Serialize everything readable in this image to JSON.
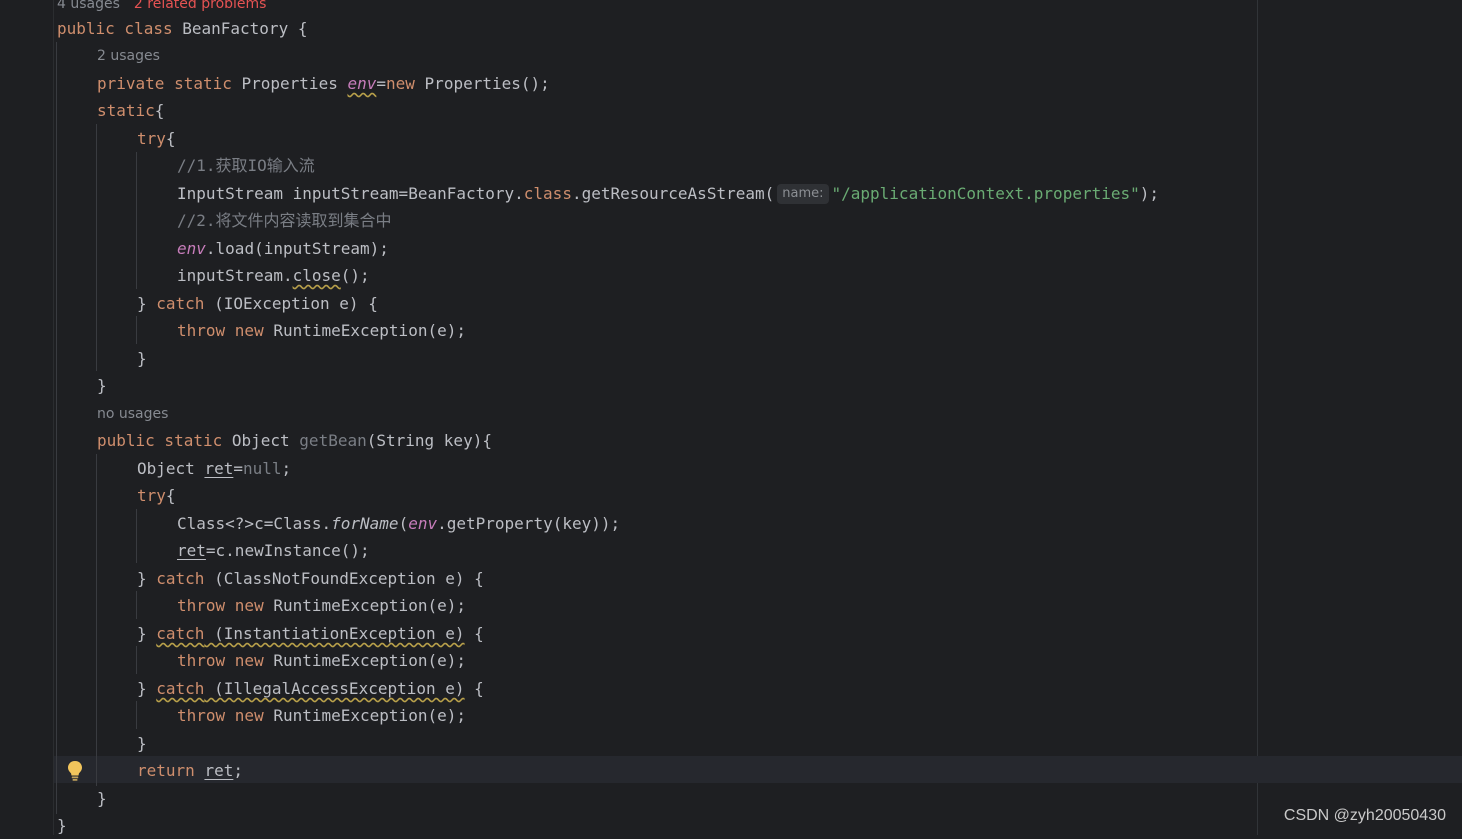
{
  "inlays": {
    "class_usages": "4 usages",
    "class_problems": "2 related problems",
    "field_usages": "2 usages",
    "method_usages": "no usages"
  },
  "code": {
    "l1_kw": "public class ",
    "l1_rest": "BeanFactory {",
    "l2_kw": "private static ",
    "l2_type": "Properties ",
    "l2_field": "env",
    "l2_eq": "=",
    "l2_new": "new ",
    "l2_rest": "Properties();",
    "l3_kw": "static",
    "l3_rest": "{",
    "l4_kw": "try",
    "l4_rest": "{",
    "l5_comment": "//1.获取IO输入流",
    "l6_pre": "InputStream inputStream=BeanFactory.",
    "l6_cls": "class",
    "l6_mid": ".getResourceAsStream(",
    "l6_hint": "name:",
    "l6_str": "\"/applicationContext.properties\"",
    "l6_end": ");",
    "l7_comment": "//2.将文件内容读取到集合中",
    "l8_field": "env",
    "l8_rest": ".load(inputStream);",
    "l9_pre": "inputStream.",
    "l9_close": "close",
    "l9_end": "();",
    "l10_brace": "} ",
    "l10_kw": "catch",
    "l10_rest": " (IOException e) {",
    "l11_kw": "throw new ",
    "l11_rest": "RuntimeException(e);",
    "l12": "}",
    "l13": "}",
    "l14_kw": "public static ",
    "l14_type": "Object ",
    "l14_name": "getBean",
    "l14_rest": "(String key){",
    "l15_type": "Object ",
    "l15_var": "ret",
    "l15_eq": "=",
    "l15_null": "null",
    "l15_end": ";",
    "l16_kw": "try",
    "l16_rest": "{",
    "l17_pre": "Class<?>c=Class.",
    "l17_forname": "forName",
    "l17_open": "(",
    "l17_field": "env",
    "l17_rest": ".getProperty(key));",
    "l18_var": "ret",
    "l18_rest": "=c.newInstance();",
    "l19_brace": "} ",
    "l19_kw": "catch",
    "l19_rest": " (ClassNotFoundException e) {",
    "l20_kw": "throw new ",
    "l20_rest": "RuntimeException(e);",
    "l21_brace": "} ",
    "l21_kw": "catch",
    "l21_u": " (InstantiationException e)",
    "l21_end": " {",
    "l22_kw": "throw new ",
    "l22_rest": "RuntimeException(e);",
    "l23_brace": "} ",
    "l23_kw": "catch",
    "l23_u": " (IllegalAccessException e)",
    "l23_end": " {",
    "l24_kw": "throw new ",
    "l24_rest": "RuntimeException(e);",
    "l25": "}",
    "l26_kw": "return ",
    "l26_var": "ret",
    "l26_end": ";",
    "l27": "}",
    "l28": "}"
  },
  "watermark": "CSDN @zyh20050430",
  "colors": {
    "background": "#1e1f22",
    "keyword": "#cf8e6d",
    "field": "#c77dbb",
    "string": "#6aab73",
    "comment": "#7a7e85",
    "text": "#bcbec4",
    "problems": "#e55353"
  }
}
